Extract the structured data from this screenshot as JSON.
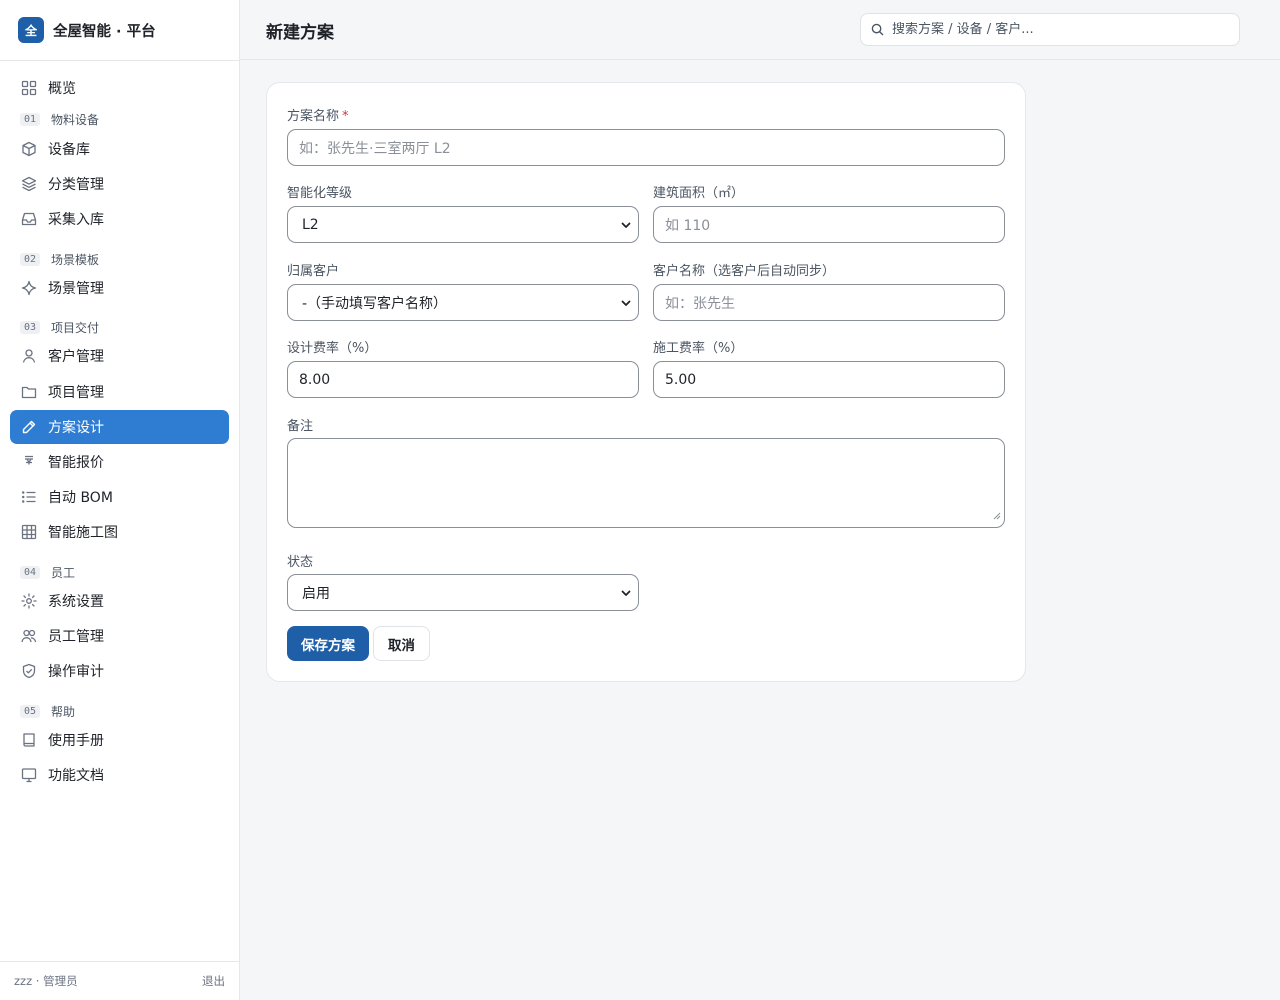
{
  "brand": {
    "logo_text": "全",
    "title": "全屋智能 · 平台"
  },
  "sidebar": {
    "overview": "概览",
    "sections": [
      {
        "num": "01",
        "label": "物料设备"
      },
      {
        "num": "02",
        "label": "场景模板"
      },
      {
        "num": "03",
        "label": "项目交付"
      },
      {
        "num": "04",
        "label": "员工"
      },
      {
        "num": "05",
        "label": "帮助"
      }
    ],
    "items": {
      "device_library": "设备库",
      "category": "分类管理",
      "collect": "采集入库",
      "scene": "场景管理",
      "customer": "客户管理",
      "project": "项目管理",
      "plan_design": "方案设计",
      "quote": "智能报价",
      "bom": "自动 BOM",
      "drawing": "智能施工图",
      "settings": "系统设置",
      "staff": "员工管理",
      "audit": "操作审计",
      "manual": "使用手册",
      "docs": "功能文档"
    },
    "active_item": "方案设计",
    "footer": {
      "user": "zzz · 管理员",
      "logout": "退出"
    }
  },
  "header": {
    "title": "新建方案",
    "search_placeholder": "搜索方案 / 设备 / 客户..."
  },
  "form": {
    "name_label": "方案名称",
    "name_required_mark": "*",
    "name_placeholder": "如：张先生·三室两厅 L2",
    "level_label": "智能化等级",
    "level_value": "L2",
    "area_label": "建筑面积（㎡）",
    "area_placeholder": "如 110",
    "customer_label": "归属客户",
    "customer_value": "-（手动填写客户名称）",
    "customer_name_label": "客户名称（选客户后自动同步）",
    "customer_name_placeholder": "如：张先生",
    "design_fee_label": "设计费率（%）",
    "design_fee_value": "8.00",
    "build_fee_label": "施工费率（%）",
    "build_fee_value": "5.00",
    "remark_label": "备注",
    "remark_value": "",
    "status_label": "状态",
    "status_value": "启用",
    "save_label": "保存方案",
    "cancel_label": "取消"
  },
  "colors": {
    "accent": "#2f7dd3",
    "primary_button": "#1f5fa8",
    "required": "#d03a3a"
  }
}
